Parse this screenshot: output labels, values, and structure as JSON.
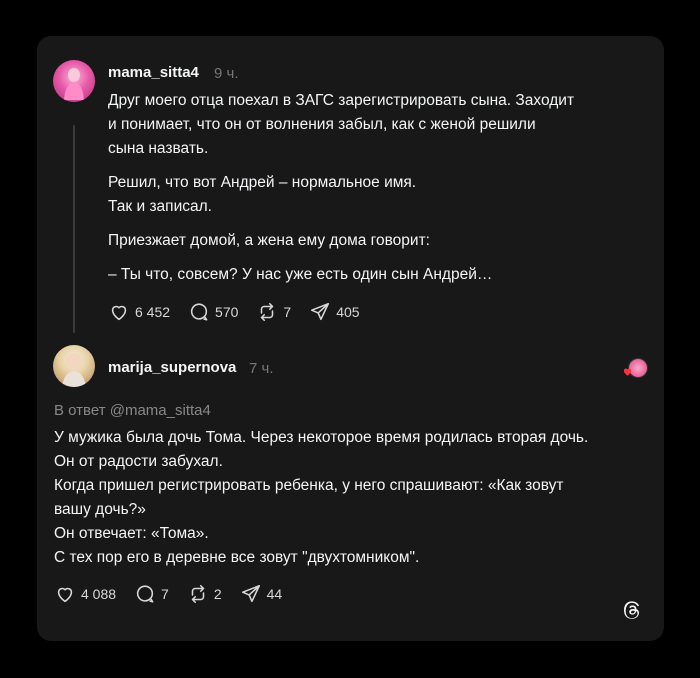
{
  "posts": [
    {
      "username": "mama_sitta4",
      "time": "9 ч.",
      "paragraphs": [
        "Друг моего отца поехал в ЗАГС зарегистрировать сына. Заходит\nи понимает, что он от волнения забыл, как с женой решили\nсына назвать.",
        "Решил, что вот Андрей – нормальное имя.\nТак и записал.",
        "Приезжает домой, а жена ему дома говорит:",
        "– Ты что, совсем? У нас уже есть один сын Андрей…"
      ],
      "likes": "6 452",
      "comments": "570",
      "reposts": "7",
      "shares": "405"
    },
    {
      "username": "marija_supernova",
      "time": "7 ч.",
      "reply_to": "В ответ @mama_sitta4",
      "text": "У мужика была дочь Тома. Через некоторое время родилась вторая дочь.\nОн от радости забухал.\nКогда пришел регистрировать ребенка, у него спрашивают: «Как зовут\nвашу дочь?»\nОн отвечает: «Тома».\nС тех пор его в деревне все зовут \"двухтомником\".",
      "likes": "4 088",
      "comments": "7",
      "reposts": "2",
      "shares": "44"
    }
  ],
  "icons": {
    "like": "heart-icon",
    "comment": "comment-icon",
    "repost": "repost-icon",
    "share": "share-icon",
    "brand": "threads-logo"
  },
  "colors": {
    "background": "#000000",
    "card": "#181818",
    "text": "#f3f5f7",
    "muted": "#777777",
    "liked_heart": "#ff3040"
  }
}
